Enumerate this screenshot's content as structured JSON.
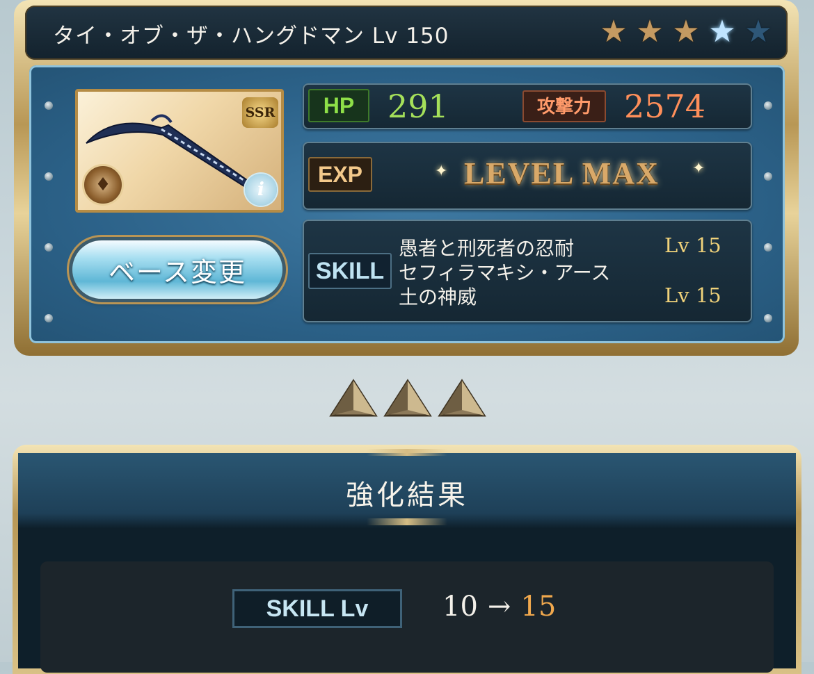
{
  "header": {
    "weapon_title": "タイ・オブ・ザ・ハングドマン Lv 150",
    "uncaps_filled": 3,
    "uncaps_blue": 1,
    "uncaps_total": 5
  },
  "weapon": {
    "rarity_badge": "SSR",
    "element_icon": "earth-element-icon",
    "info_icon": "i"
  },
  "buttons": {
    "change_base": "ベース変更"
  },
  "stats": {
    "hp_label": "HP",
    "hp_value": "291",
    "atk_label": "攻撃力",
    "atk_value": "2574",
    "exp_label": "EXP",
    "exp_status": "LEVEL MAX"
  },
  "skills": {
    "label": "SKILL",
    "items": [
      {
        "name": "愚者と刑死者の忍耐",
        "level": "Lv 15"
      },
      {
        "name": "セフィラマキシ・アース",
        "level": ""
      },
      {
        "name": "土の神威",
        "level": "Lv 15"
      }
    ]
  },
  "result": {
    "title": "強化結果",
    "skill_lv_label": "SKILL Lv",
    "from": "10",
    "arrow": "→",
    "to": "15"
  },
  "colors": {
    "hp": "#a5e05a",
    "atk": "#ff8f5a",
    "level_max": "#d9a969",
    "skill_lv": "#f0d27a",
    "result_to": "#f0a84d"
  }
}
